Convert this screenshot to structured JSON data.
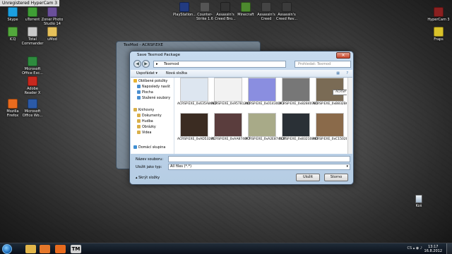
{
  "watermark": "Unregistered HyperCam 3",
  "desktop_icons": [
    {
      "label": "Skype",
      "color": "#1b9fe0",
      "icon": "skype-icon"
    },
    {
      "label": "uTorrent",
      "color": "#3f9e35",
      "icon": "utorrent-icon"
    },
    {
      "label": "Zoner Photo Studio 14",
      "color": "#6a4f9a",
      "icon": "zoner-icon"
    },
    {
      "label": "ICQ",
      "color": "#53a83c",
      "icon": "icq-icon"
    },
    {
      "label": "Total Commander",
      "color": "#c9c9c9",
      "icon": "total-commander-icon"
    },
    {
      "label": "uMod",
      "color": "#e6c15a",
      "icon": "folder-icon"
    },
    {
      "label": "Microsoft Office Exc...",
      "color": "#2e8b3e",
      "icon": "excel-icon"
    },
    {
      "label": "Adobe Reader X",
      "color": "#c8281e",
      "icon": "adobe-reader-icon"
    },
    {
      "label": "Mozilla Firefox",
      "color": "#e86b1e",
      "icon": "firefox-icon"
    },
    {
      "label": "Microsoft Office Wo...",
      "color": "#2b5aa8",
      "icon": "word-icon"
    },
    {
      "label": "HyperCam 3",
      "color": "#8a2020",
      "icon": "hypercam-icon"
    },
    {
      "label": "Fraps",
      "color": "#d9c22a",
      "icon": "fraps-icon"
    },
    {
      "label": "PlayStation...",
      "color": "#223b80",
      "icon": "game-icon"
    },
    {
      "label": "Counter-Strike 1.6",
      "color": "#555555",
      "icon": "game-icon"
    },
    {
      "label": "Assassin's Creed Bro...",
      "color": "#333333",
      "icon": "game-icon"
    },
    {
      "label": "Minecraft",
      "color": "#4d8a2e",
      "icon": "game-icon"
    },
    {
      "label": "Assassin's Creed",
      "color": "#444444",
      "icon": "game-icon"
    },
    {
      "label": "Assassin's Creed Rev...",
      "color": "#3b3b3b",
      "icon": "game-icon"
    }
  ],
  "texmod_window": {
    "title": "TexMod - ACRSP.EXE"
  },
  "dialog": {
    "title": "Save Texmod Package",
    "address": "Texmod",
    "search_placeholder": "Prohledat: Texmod",
    "toolbar": {
      "organize": "Uspořádat ▾",
      "new_folder": "Nová složka"
    },
    "sidebar": [
      {
        "label": "Oblíbené položky",
        "color": "#e8b330",
        "icon": "favorites-icon"
      },
      {
        "label": "Naposledy navšt",
        "color": "#4a8fd0",
        "icon": "recent-icon"
      },
      {
        "label": "Plocha",
        "color": "#4a8fd0",
        "icon": "desktop-icon"
      },
      {
        "label": "Stažené soubory",
        "color": "#4a8fd0",
        "icon": "downloads-icon"
      },
      {
        "label": "Knihovny",
        "color": "#d9b04a",
        "icon": "libraries-icon"
      },
      {
        "label": "Dokumenty",
        "color": "#d9b04a",
        "icon": "documents-icon"
      },
      {
        "label": "Hudba",
        "color": "#d9b04a",
        "icon": "music-icon"
      },
      {
        "label": "Obrázky",
        "color": "#d9b04a",
        "icon": "pictures-icon"
      },
      {
        "label": "Videa",
        "color": "#d9b04a",
        "icon": "videos-icon"
      },
      {
        "label": "Domácí skupina",
        "color": "#3f8fd2",
        "icon": "homegroup-icon"
      }
    ],
    "files": [
      {
        "name": "ACRSP.EXE_0x635A868D",
        "color": "#dde6f0"
      },
      {
        "name": "ACRSP.EXE_0x95781240",
        "color": "#f2f2f2"
      },
      {
        "name": "ACRSP.EXE_0x01430DF3",
        "color": "#8a8ee0"
      },
      {
        "name": "ACRSP.EXE_0x828407B1",
        "color": "#777777"
      },
      {
        "name": "ACRSP.EXE_0xB832B67",
        "color": "#7a6b55"
      },
      {
        "name": "ACRSP.EXE_0xAD53285",
        "color": "#3b2c22"
      },
      {
        "name": "ACRSP.EXE_0xAA8740F7",
        "color": "#5a3d3d"
      },
      {
        "name": "ACRSP.EXE_0xA2E87432F",
        "color": "#a8aa88"
      },
      {
        "name": "ACRSP.EXE_0x83210840",
        "color": "#2a3036"
      },
      {
        "name": "ACRSP.EXE_0xC1502B04",
        "color": "#8a6a4a"
      }
    ],
    "tooltip": "ACRSP.EXE_0x88532851",
    "filename_label": "Název souboru:",
    "filename_value": "",
    "filetype_label": "Uložit jako typ:",
    "filetype_value": "All files (*.*)",
    "hide_folders": "Skrýt složky",
    "save_button": "Uložit",
    "cancel_button": "Storno"
  },
  "recycle_bin": "Koš",
  "taskbar": {
    "apps": [
      {
        "icon": "explorer-icon",
        "color": "#e2b549"
      },
      {
        "icon": "media-player-icon",
        "color": "#e5772a"
      },
      {
        "icon": "firefox-icon",
        "color": "#e86b1e"
      },
      {
        "icon": "texmod-icon",
        "color": "#d0d0d0"
      }
    ],
    "language": "CS",
    "time": "13:17",
    "date": "16.8.2012"
  }
}
